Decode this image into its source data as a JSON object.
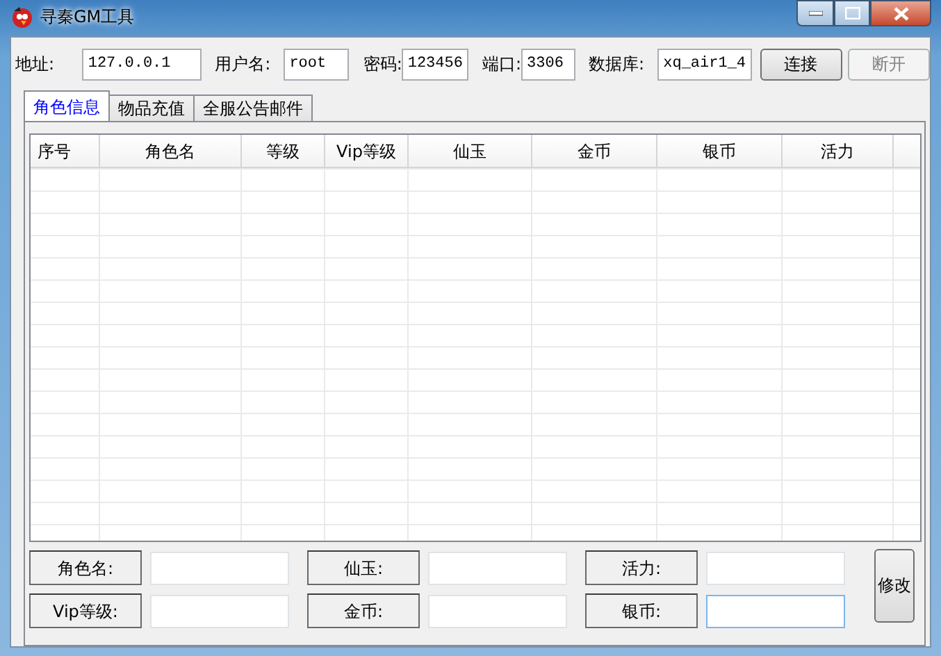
{
  "window": {
    "title": "寻秦GM工具"
  },
  "connection": {
    "fields": [
      {
        "label": "地址:",
        "value": "127.0.0.1"
      },
      {
        "label": "用户名:",
        "value": "root"
      },
      {
        "label": "密码:",
        "value": "123456"
      },
      {
        "label": "端口:",
        "value": "3306"
      },
      {
        "label": "数据库:",
        "value": "xq_air1_4"
      }
    ],
    "buttons": [
      {
        "label": "连接",
        "disabled": false
      },
      {
        "label": "断开",
        "disabled": true
      }
    ]
  },
  "tabs": [
    {
      "label": "角色信息",
      "selected": true
    },
    {
      "label": "物品充值",
      "selected": false
    },
    {
      "label": "全服公告邮件",
      "selected": false
    }
  ],
  "table": {
    "columns": [
      "序号",
      "角色名",
      "等级",
      "Vip等级",
      "仙玉",
      "金币",
      "银币",
      "活力"
    ]
  },
  "edit_form": {
    "fields": [
      {
        "label": "角色名:",
        "focused": false
      },
      {
        "label": "仙玉:",
        "focused": false
      },
      {
        "label": "活力:",
        "focused": false
      },
      {
        "label": "Vip等级:",
        "focused": false
      },
      {
        "label": "金币:",
        "focused": false
      },
      {
        "label": "银币:",
        "focused": true
      }
    ],
    "button": "修改"
  }
}
